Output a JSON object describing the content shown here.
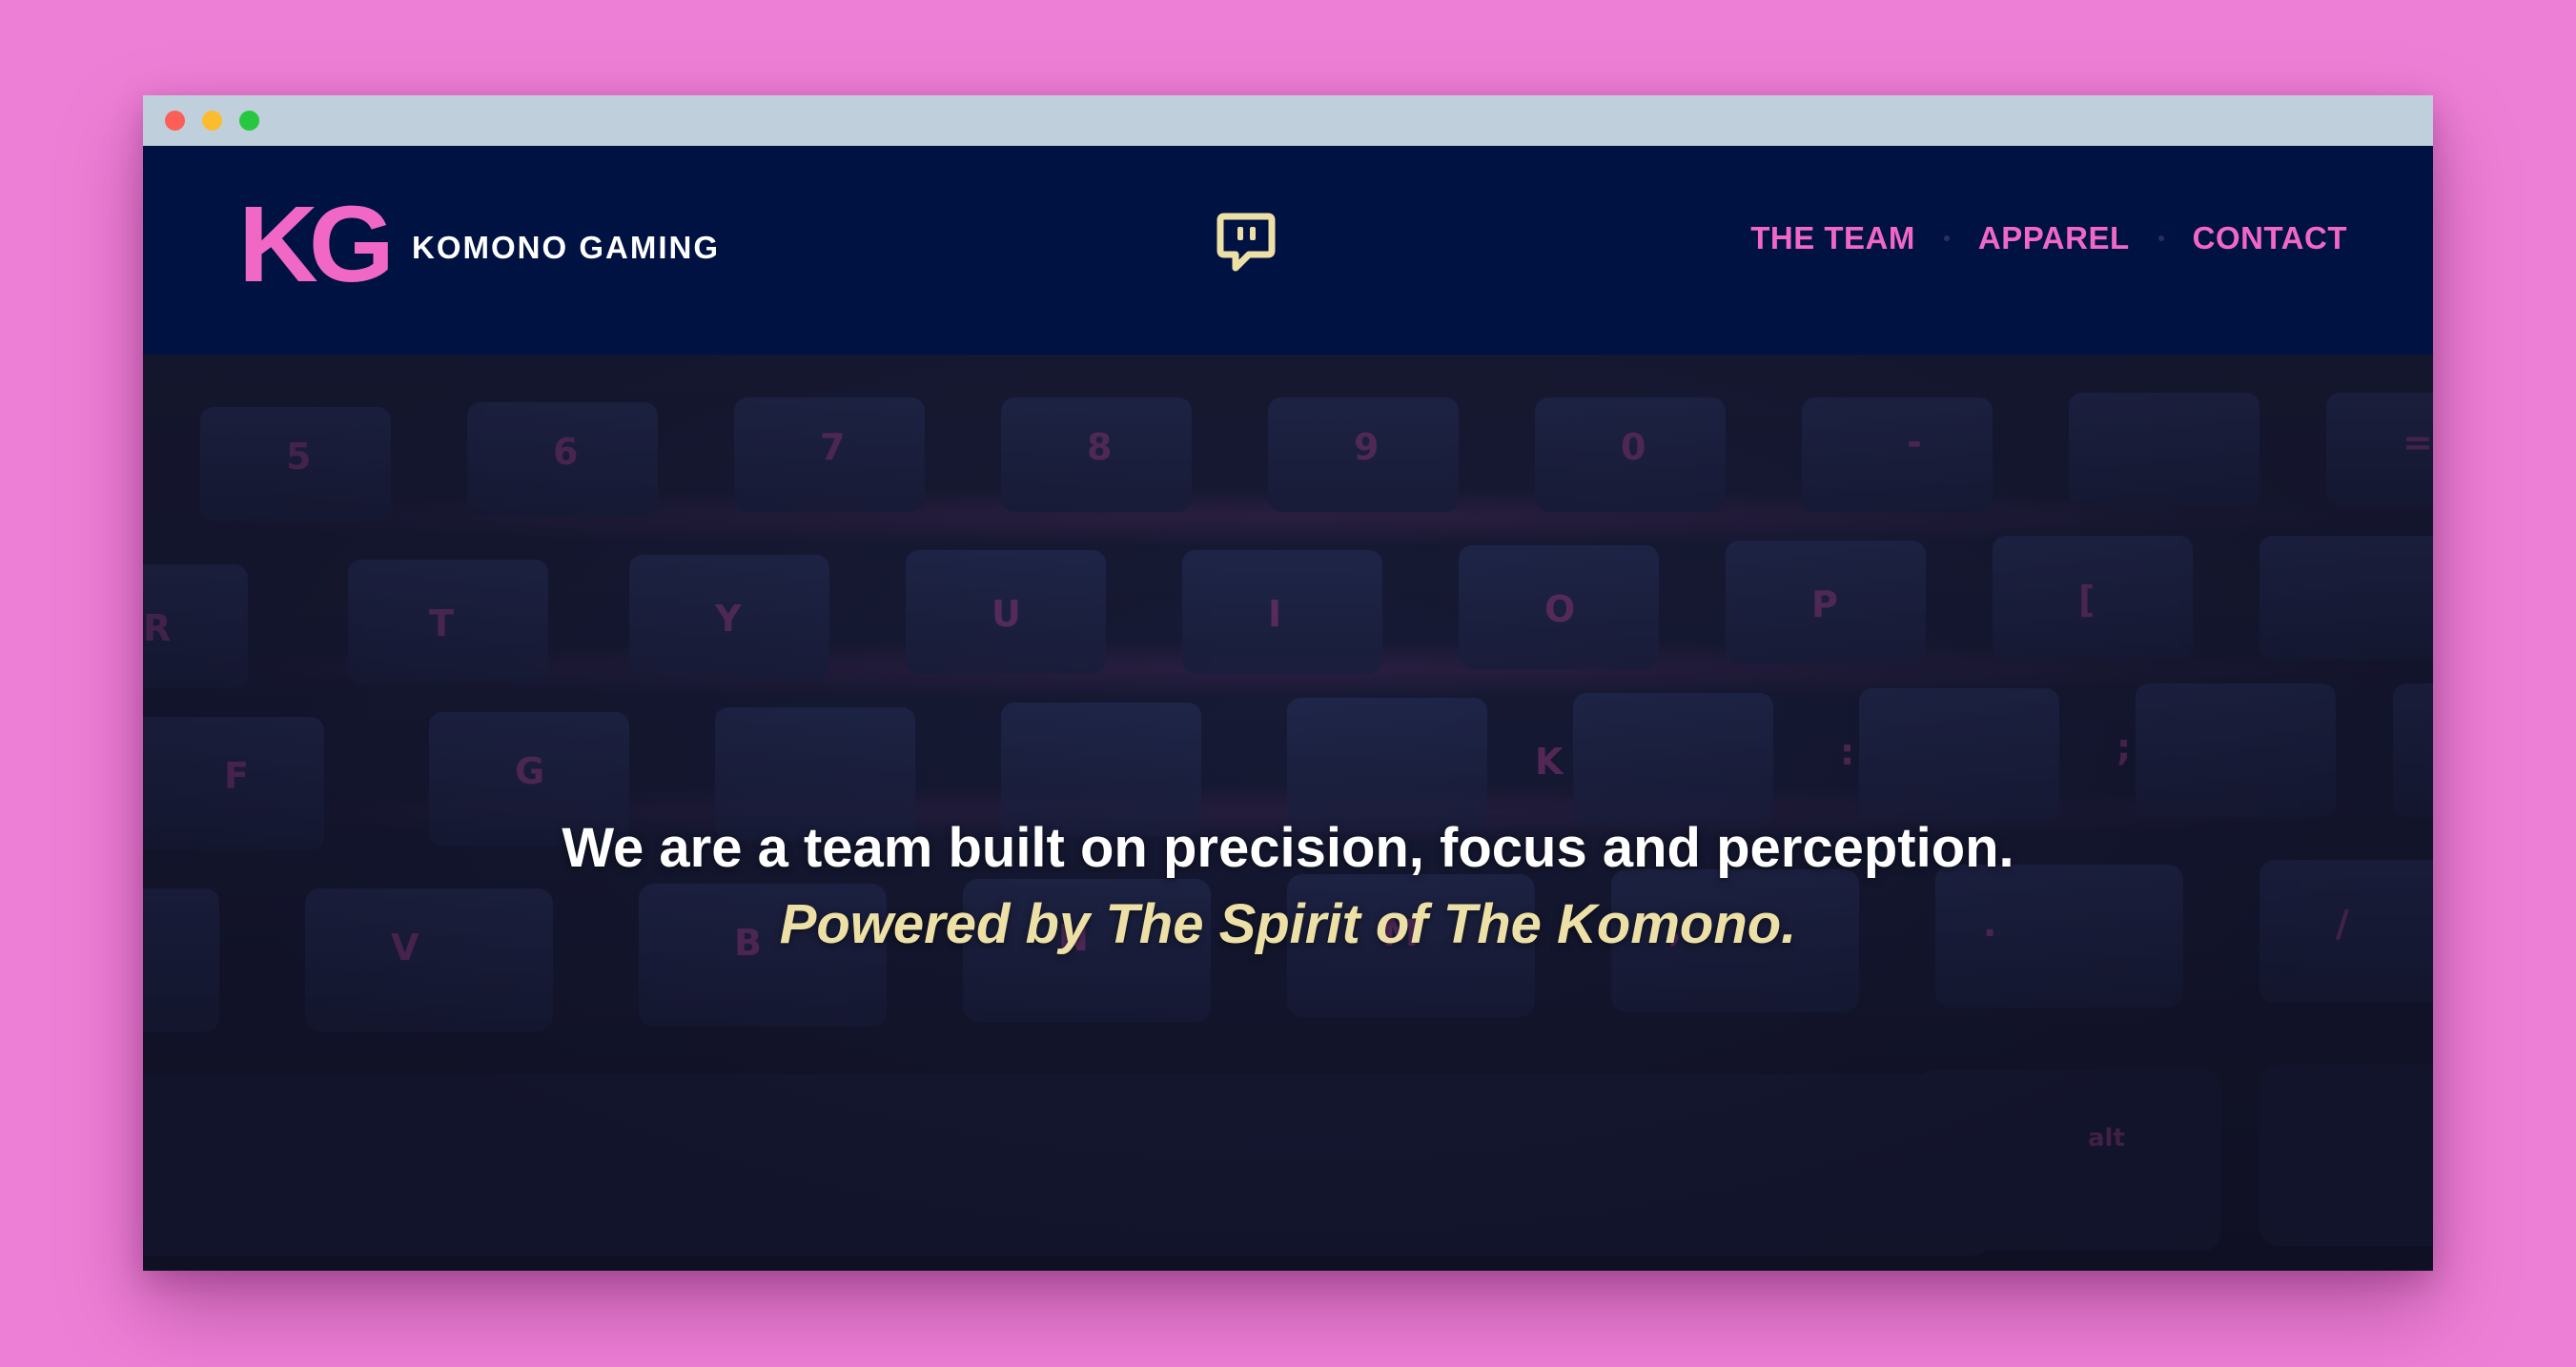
{
  "colors": {
    "page_background": "#ee7fd6",
    "header_background": "#001242",
    "accent_pink": "#f067c6",
    "accent_cream": "#ede0a6",
    "window_chrome": "#bfcfdc"
  },
  "window": {
    "controls": [
      "close",
      "minimize",
      "maximize"
    ]
  },
  "header": {
    "logo_mark": "KG",
    "logo_text": "KOMONO GAMING",
    "social_icon": "twitch-icon",
    "nav": [
      {
        "label": "THE TEAM"
      },
      {
        "label": "APPAREL"
      },
      {
        "label": "CONTACT"
      }
    ]
  },
  "hero": {
    "background": "keyboard-photo",
    "headline": "We are a team built on precision, focus and perception.",
    "tagline": "Powered by The Spirit of The Komono."
  }
}
